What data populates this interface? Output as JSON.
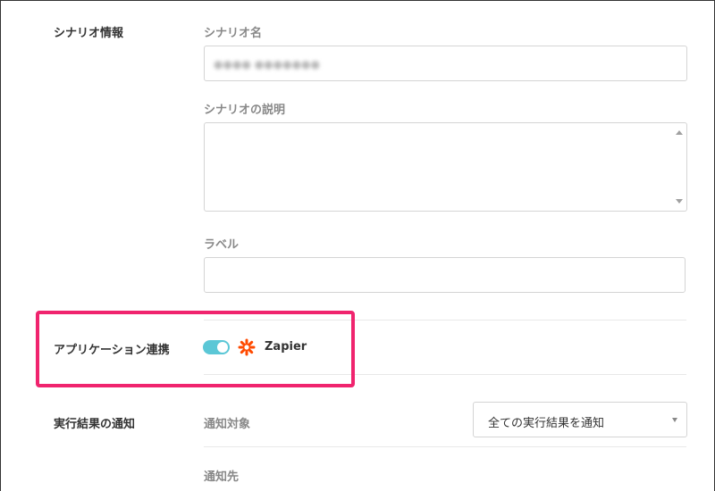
{
  "scenario_info": {
    "section_label": "シナリオ情報",
    "name_label": "シナリオ名",
    "name_value": "●●●● ●●●●●●●",
    "description_label": "シナリオの説明",
    "description_value": "",
    "label_label": "ラベル",
    "label_value": ""
  },
  "app_integration": {
    "section_label": "アプリケーション連携",
    "toggle_on": true,
    "app_name": "Zapier",
    "zapier_color": "#ff4a00",
    "toggle_color": "#5bc7d6",
    "highlight_color": "#f0246e"
  },
  "notification": {
    "section_label": "実行結果の通知",
    "target_label": "通知対象",
    "target_selected": "全ての実行結果を通知",
    "destination_label": "通知先"
  }
}
